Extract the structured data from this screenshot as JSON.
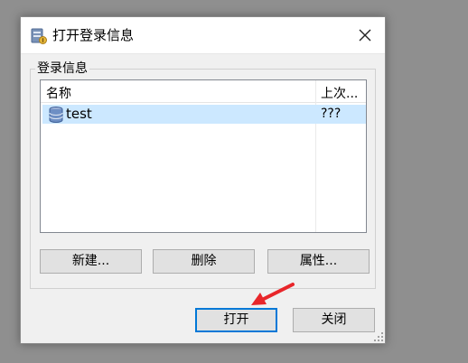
{
  "dialog": {
    "title": "打开登录信息",
    "title_icon": "database-icon",
    "close_icon": "close-icon"
  },
  "group": {
    "label": "登录信息"
  },
  "list": {
    "columns": [
      "名称",
      "上次..."
    ],
    "rows": [
      {
        "name": "test",
        "last": "???",
        "icon": "database-icon",
        "selected": true
      }
    ]
  },
  "buttons": {
    "new": "新建...",
    "delete": "删除",
    "properties": "属性...",
    "open": "打开",
    "close": "关闭"
  },
  "colors": {
    "selection": "#cce8ff",
    "accent": "#0078d7",
    "arrow": "#e8262a"
  }
}
